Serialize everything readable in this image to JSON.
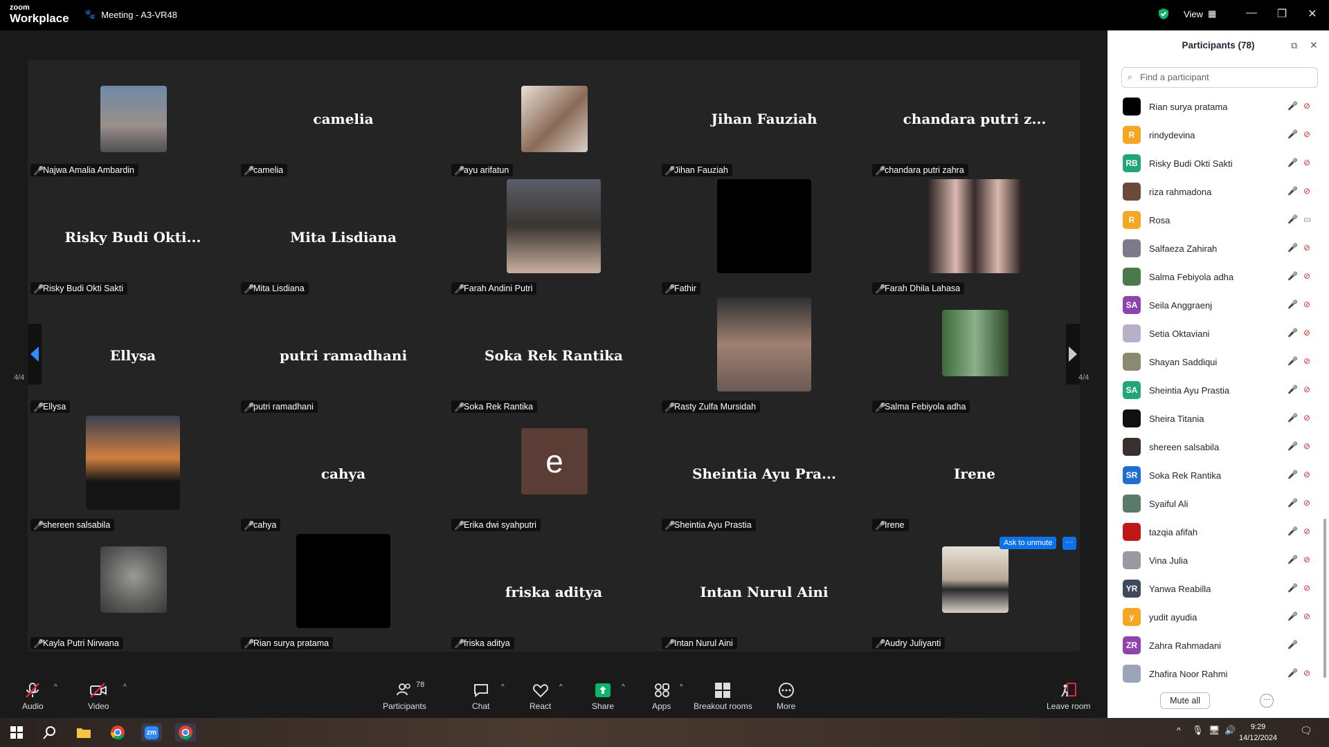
{
  "window": {
    "brand_small": "zoom",
    "brand_big": "Workplace",
    "meeting_title": "Meeting - A3-VR48",
    "view_label": "View"
  },
  "gallery": {
    "page_indicator_left": "4/4",
    "page_indicator_right": "4/4",
    "ask_to_unmute_label": "Ask to unmute",
    "more_label": "···",
    "tiles": [
      {
        "label": "Najwa Amalia Ambardin",
        "center": ""
      },
      {
        "label": "camelia",
        "center": "camelia"
      },
      {
        "label": "ayu arifatun",
        "center": ""
      },
      {
        "label": "Jihan Fauziah",
        "center": "Jihan Fauziah"
      },
      {
        "label": "chandara putri zahra",
        "center": "chandara putri z..."
      },
      {
        "label": "Risky Budi Okti Sakti",
        "center": "Risky Budi Okti..."
      },
      {
        "label": "Mita Lisdiana",
        "center": "Mita Lisdiana"
      },
      {
        "label": "Farah Andini Putri",
        "center": ""
      },
      {
        "label": "Fathir",
        "center": ""
      },
      {
        "label": "Farah Dhila Lahasa",
        "center": ""
      },
      {
        "label": "Ellysa",
        "center": "Ellysa"
      },
      {
        "label": "putri ramadhani",
        "center": "putri ramadhani"
      },
      {
        "label": "Soka Rek Rantika",
        "center": "Soka Rek Rantika"
      },
      {
        "label": "Rasty Zulfa Mursidah",
        "center": ""
      },
      {
        "label": "Salma Febiyola adha",
        "center": ""
      },
      {
        "label": "shereen salsabila",
        "center": ""
      },
      {
        "label": "cahya",
        "center": "cahya"
      },
      {
        "label": "Erika dwi syahputri",
        "center": "e"
      },
      {
        "label": "Sheintia Ayu Prastia",
        "center": "Sheintia Ayu Pra..."
      },
      {
        "label": "Irene",
        "center": "Irene"
      },
      {
        "label": "Kayla Putri Nirwana",
        "center": ""
      },
      {
        "label": "Rian surya pratama",
        "center": ""
      },
      {
        "label": "friska aditya",
        "center": "friska aditya"
      },
      {
        "label": "Intan Nurul Aini",
        "center": "Intan Nurul Aini"
      },
      {
        "label": "Audry Juliyanti",
        "center": ""
      }
    ]
  },
  "participants": {
    "title": "Participants (78)",
    "search_placeholder": "Find a participant",
    "mute_all_label": "Mute all",
    "more_label": "···",
    "list": [
      {
        "name": "Rian surya pratama",
        "initials": "",
        "color": "#000000",
        "video": "off"
      },
      {
        "name": "rindydevina",
        "initials": "R",
        "color": "#f5a623",
        "video": "off"
      },
      {
        "name": "Risky Budi Okti Sakti",
        "initials": "RB",
        "color": "#21a67a",
        "video": "off"
      },
      {
        "name": "riza rahmadona",
        "initials": "",
        "color": "#6b4a3a",
        "video": "off"
      },
      {
        "name": "Rosa",
        "initials": "R",
        "color": "#f5a623",
        "video": "on"
      },
      {
        "name": "Salfaeza Zahirah",
        "initials": "",
        "color": "#7a7a8a",
        "video": "off"
      },
      {
        "name": "Salma Febiyola adha",
        "initials": "",
        "color": "#4a7a4a",
        "video": "off"
      },
      {
        "name": "Seila Anggraenj",
        "initials": "SA",
        "color": "#8e44ad",
        "video": "off"
      },
      {
        "name": "Setia Oktaviani",
        "initials": "",
        "color": "#b8b0c8",
        "video": "off"
      },
      {
        "name": "Shayan Saddiqui",
        "initials": "",
        "color": "#8a8a70",
        "video": "off"
      },
      {
        "name": "Sheintia Ayu Prastia",
        "initials": "SA",
        "color": "#21a67a",
        "video": "off"
      },
      {
        "name": "Sheira Titania",
        "initials": "",
        "color": "#111111",
        "video": "off"
      },
      {
        "name": "shereen salsabila",
        "initials": "",
        "color": "#3a3030",
        "video": "off"
      },
      {
        "name": "Soka Rek Rantika",
        "initials": "SR",
        "color": "#1f6fd1",
        "video": "off"
      },
      {
        "name": "Syaiful Ali",
        "initials": "",
        "color": "#5a7a6a",
        "video": "off"
      },
      {
        "name": "tazqia afifah",
        "initials": "",
        "color": "#c0171b",
        "video": "off"
      },
      {
        "name": "Vina Julia",
        "initials": "",
        "color": "#9a9aa0",
        "video": "off"
      },
      {
        "name": "Yanwa Reabilla",
        "initials": "YR",
        "color": "#3c4a5c",
        "video": "off"
      },
      {
        "name": "yudit ayudia",
        "initials": "y",
        "color": "#f5a623",
        "video": "off"
      },
      {
        "name": "Zahra Rahmadani",
        "initials": "ZR",
        "color": "#8e44ad",
        "video": "none"
      },
      {
        "name": "Zhafira Noor Rahmi",
        "initials": "",
        "color": "#9aa5b5",
        "video": "off"
      }
    ]
  },
  "toolbar": {
    "audio": "Audio",
    "video": "Video",
    "participants": "Participants",
    "participants_count": "78",
    "chat": "Chat",
    "react": "React",
    "share": "Share",
    "apps": "Apps",
    "breakout": "Breakout rooms",
    "more": "More",
    "leave": "Leave room"
  },
  "taskbar": {
    "time": "9:29",
    "date": "14/12/2024"
  },
  "colors": {
    "accent": "#0e72ed",
    "share_green": "#0bb56a",
    "muted_red": "#e0283c"
  }
}
